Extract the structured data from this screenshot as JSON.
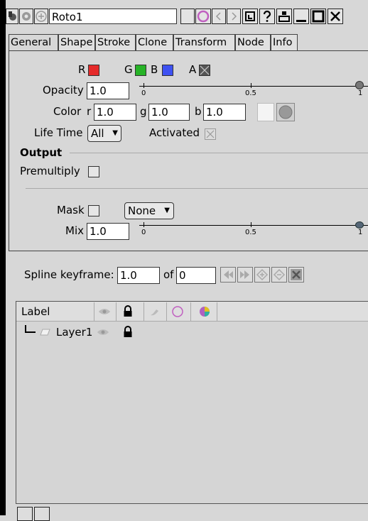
{
  "title_bar": {
    "node_name": "Roto1"
  },
  "tabs": [
    {
      "label": "General"
    },
    {
      "label": "Shape"
    },
    {
      "label": "Stroke"
    },
    {
      "label": "Clone"
    },
    {
      "label": "Transform"
    },
    {
      "label": "Node"
    },
    {
      "label": "Info"
    }
  ],
  "channels": {
    "r": "R",
    "g": "G",
    "b": "B",
    "a": "A",
    "colors": {
      "r": "#e52a2a",
      "g": "#27b327",
      "b": "#3e52f2",
      "a": "#555555"
    }
  },
  "opacity": {
    "label": "Opacity",
    "value": "1.0",
    "ticks": [
      "0",
      "0.5",
      "1"
    ],
    "level": 1.0
  },
  "color": {
    "label": "Color",
    "r_label": "r",
    "r": "1.0",
    "g_label": "g",
    "g": "1.0",
    "b_label": "b",
    "b": "1.0"
  },
  "lifetime": {
    "label": "Life Time",
    "value": "All",
    "activated_label": "Activated"
  },
  "output": {
    "heading": "Output",
    "premultiply_label": "Premultiply"
  },
  "mask": {
    "label": "Mask",
    "value": "None"
  },
  "mix": {
    "label": "Mix",
    "value": "1.0",
    "ticks": [
      "0",
      "0.5",
      "1"
    ],
    "level": 1.0
  },
  "spline": {
    "label": "Spline keyframe:",
    "value": "1.0",
    "of_label": "of",
    "of_value": "0"
  },
  "layers": {
    "header": {
      "label": "Label"
    },
    "rows": [
      {
        "name": "Layer1"
      }
    ]
  }
}
